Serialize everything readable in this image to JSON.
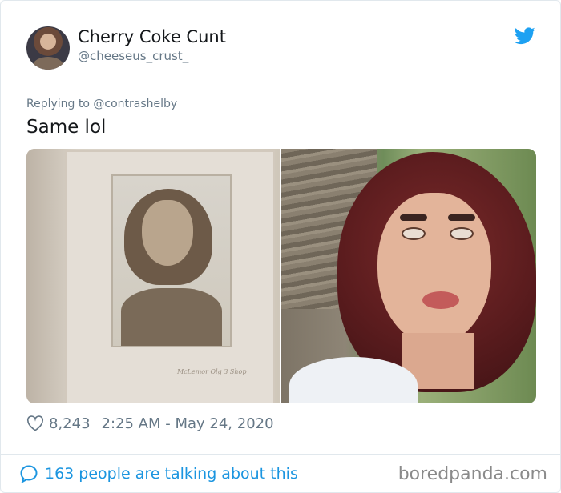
{
  "tweet": {
    "author_name": "Cherry Coke Cunt",
    "author_handle": "@cheeseus_crust_",
    "reply_line": "Replying to @contrashelby",
    "text": "Same lol",
    "like_count": "8,243",
    "timestamp": "2:25 AM - May 24, 2020",
    "talking_about": "163 people are talking about this"
  },
  "media": {
    "left_photo_caption": "McLemor Olg 3 Shop"
  },
  "watermark": "boredpanda.com",
  "icons": {
    "brand": "twitter-bird-icon",
    "like": "heart-icon",
    "reply": "speech-bubble-icon"
  },
  "colors": {
    "twitter_blue": "#1da1f2",
    "link_blue": "#1b95e0",
    "muted_text": "#657786",
    "border": "#e1e8ed"
  }
}
